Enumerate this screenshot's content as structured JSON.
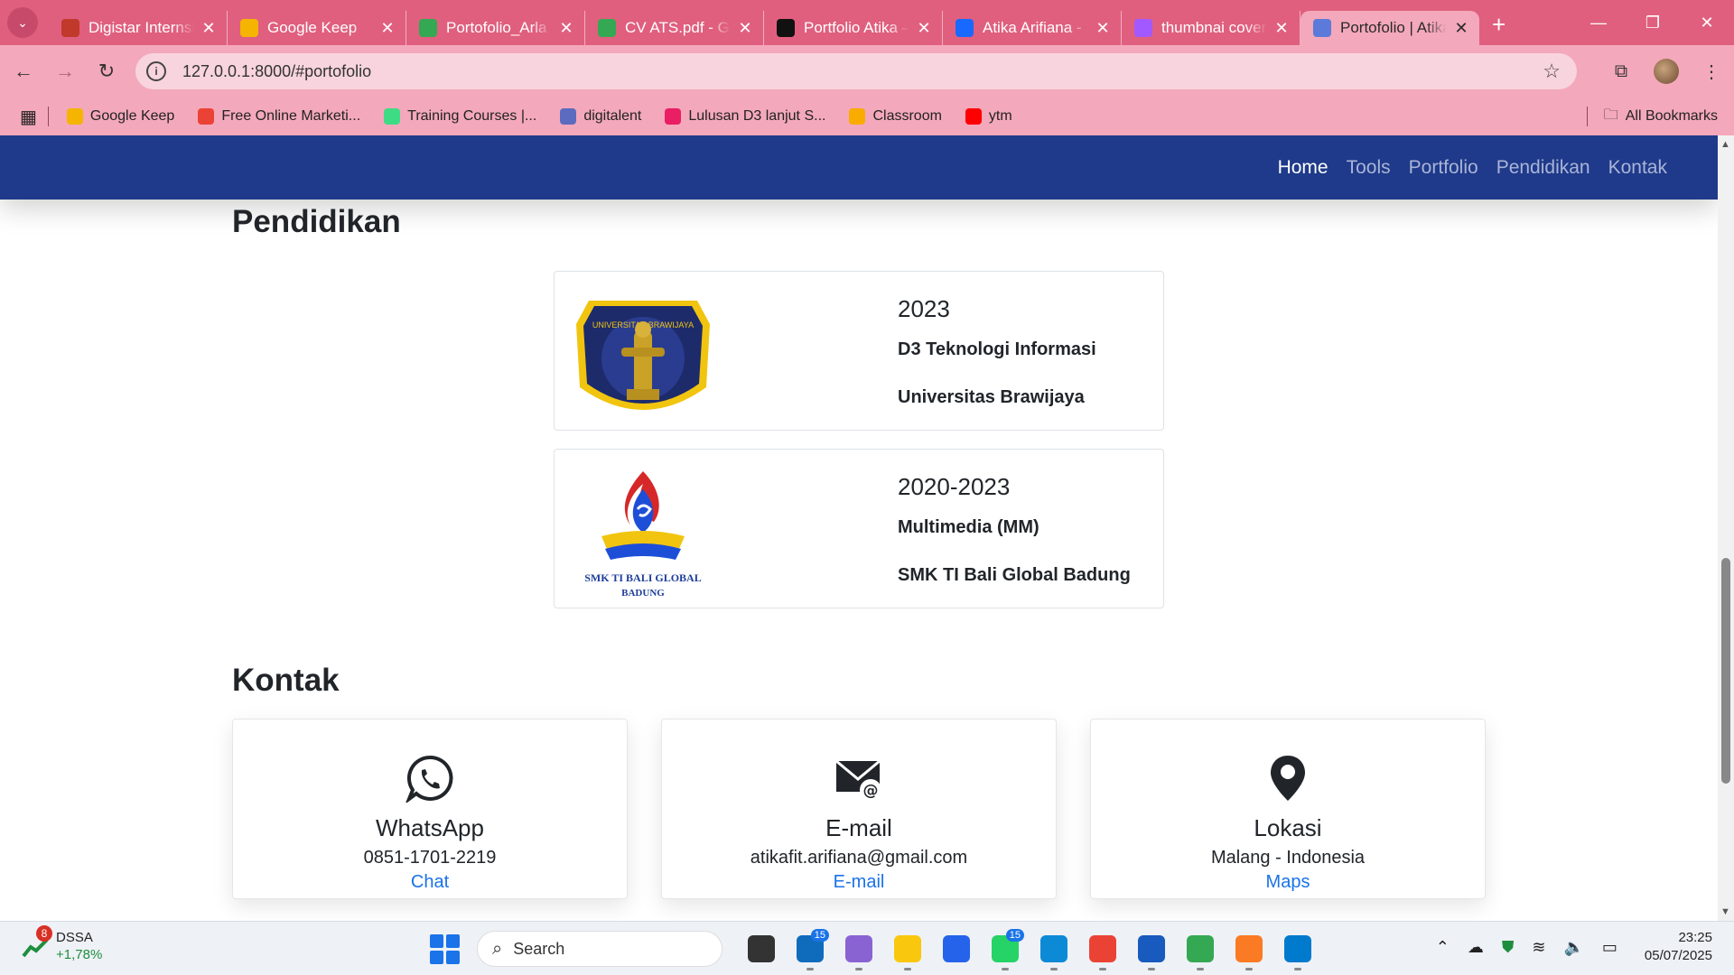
{
  "browser": {
    "tabs": [
      {
        "title": "Digistar Internship",
        "favicon_color": "#c0392b"
      },
      {
        "title": "Google Keep",
        "favicon_color": "#f4b400"
      },
      {
        "title": "Portofolio_Arla Tu",
        "favicon_color": "#34a853"
      },
      {
        "title": "CV ATS.pdf - Goo",
        "favicon_color": "#34a853"
      },
      {
        "title": "Portfolio Atika –",
        "favicon_color": "#111111"
      },
      {
        "title": "Atika Arifiana - S",
        "favicon_color": "#1769ff"
      },
      {
        "title": "thumbnai cover",
        "favicon_color": "#a259ff"
      },
      {
        "title": "Portofolio | Atika",
        "favicon_color": "#5b7ad9",
        "active": true
      }
    ],
    "url": "127.0.0.1:8000/#portofolio",
    "bookmarks": [
      {
        "label": "Google Keep",
        "color": "#f4b400"
      },
      {
        "label": "Free Online Marketi...",
        "color": "#ea4335"
      },
      {
        "label": "Training Courses |...",
        "color": "#3ddc84"
      },
      {
        "label": "digitalent",
        "color": "#5c6bc0"
      },
      {
        "label": "Lulusan D3 lanjut S...",
        "color": "#e91e63"
      },
      {
        "label": "Classroom",
        "color": "#f9ab00"
      },
      {
        "label": "ytm",
        "color": "#ff0000"
      }
    ],
    "all_bookmarks": "All Bookmarks"
  },
  "nav": {
    "items": [
      "Home",
      "Tools",
      "Portfolio",
      "Pendidikan",
      "Kontak"
    ],
    "active": "Home"
  },
  "education": {
    "title": "Pendidikan",
    "items": [
      {
        "year": "2023",
        "degree": "D3 Teknologi Informasi",
        "school": "Universitas Brawijaya",
        "logo_text": "UNIVERSITAS BRAWIJAYA"
      },
      {
        "year": "2020-2023",
        "degree": "Multimedia (MM)",
        "school": "SMK TI Bali Global Badung",
        "logo_text": "SMK TI BALI GLOBAL",
        "logo_sub": "BADUNG"
      }
    ]
  },
  "contact": {
    "title": "Kontak",
    "cards": [
      {
        "icon": "whatsapp-icon",
        "label": "WhatsApp",
        "value": "0851-1701-2219",
        "link": "Chat"
      },
      {
        "icon": "email-icon",
        "label": "E-mail",
        "value": "atikafit.arifiana@gmail.com",
        "link": "E-mail"
      },
      {
        "icon": "location-pin-icon",
        "label": "Lokasi",
        "value": "Malang - Indonesia",
        "link": "Maps"
      }
    ]
  },
  "taskbar": {
    "stock": {
      "name": "DSSA",
      "change": "+1,78%",
      "badge": "8"
    },
    "search_placeholder": "Search",
    "apps": [
      {
        "name": "task-view",
        "color": "#333333"
      },
      {
        "name": "outlook",
        "color": "#0f6cbd",
        "badge": "15"
      },
      {
        "name": "copilot",
        "color": "#8a63d2"
      },
      {
        "name": "file-explorer",
        "color": "#f9c80e"
      },
      {
        "name": "store",
        "color": "#2563eb"
      },
      {
        "name": "whatsapp",
        "color": "#25d366",
        "badge": "15"
      },
      {
        "name": "edge",
        "color": "#0c8ad6"
      },
      {
        "name": "chrome",
        "color": "#ea4335"
      },
      {
        "name": "word",
        "color": "#185abd"
      },
      {
        "name": "chrome-profile",
        "color": "#34a853"
      },
      {
        "name": "xampp",
        "color": "#fb7a24"
      },
      {
        "name": "vscode",
        "color": "#007acc"
      }
    ],
    "time": "23:25",
    "date": "05/07/2025"
  }
}
